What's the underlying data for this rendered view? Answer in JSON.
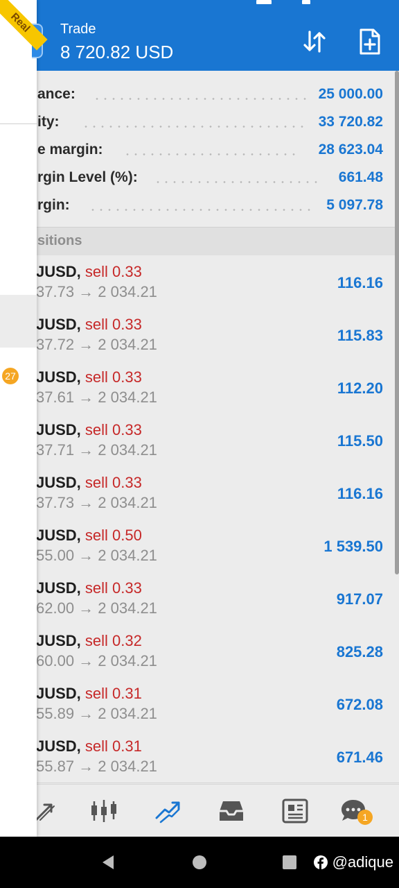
{
  "header": {
    "title": "Trade",
    "amount": "8 720.82 USD",
    "sort_icon": "sort-arrows-icon",
    "new_order_icon": "new-order-icon"
  },
  "summary": [
    {
      "label": "ance:",
      "value": "25 000.00"
    },
    {
      "label": "ity:",
      "value": "33 720.82"
    },
    {
      "label": "e margin:",
      "value": "28 623.04"
    },
    {
      "label": "rgin Level (%):",
      "value": "661.48"
    },
    {
      "label": "rgin:",
      "value": "5 097.78"
    }
  ],
  "positions_header": "sitions",
  "positions": [
    {
      "symbol": "JUSD,",
      "side": "sell 0.33",
      "prices": "37.73 → 2 034.21",
      "profit": "116.16"
    },
    {
      "symbol": "JUSD,",
      "side": "sell 0.33",
      "prices": "37.72 → 2 034.21",
      "profit": "115.83"
    },
    {
      "symbol": "JUSD,",
      "side": "sell 0.33",
      "prices": "37.61 → 2 034.21",
      "profit": "112.20"
    },
    {
      "symbol": "JUSD,",
      "side": "sell 0.33",
      "prices": "37.71 → 2 034.21",
      "profit": "115.50"
    },
    {
      "symbol": "JUSD,",
      "side": "sell 0.33",
      "prices": "37.73 → 2 034.21",
      "profit": "116.16"
    },
    {
      "symbol": "JUSD,",
      "side": "sell 0.50",
      "prices": "55.00 → 2 034.21",
      "profit": "1 539.50"
    },
    {
      "symbol": "JUSD,",
      "side": "sell 0.33",
      "prices": "62.00 → 2 034.21",
      "profit": "917.07"
    },
    {
      "symbol": "JUSD,",
      "side": "sell 0.32",
      "prices": "60.00 → 2 034.21",
      "profit": "825.28"
    },
    {
      "symbol": "JUSD,",
      "side": "sell 0.31",
      "prices": "55.89 → 2 034.21",
      "profit": "672.08"
    },
    {
      "symbol": "JUSD,",
      "side": "sell 0.31",
      "prices": "55.87 → 2 034.21",
      "profit": "671.46"
    }
  ],
  "bottom_nav": {
    "items": [
      "quotes-icon",
      "chart-candles-icon",
      "trade-icon",
      "history-inbox-icon",
      "news-icon",
      "chat-icon"
    ],
    "active": "trade-icon",
    "chat_badge": "1"
  },
  "drawer": {
    "badge": "27",
    "ribbon": "Real"
  },
  "watermark": "@adique",
  "colors": {
    "header": "#1976d2",
    "accent": "#1976d2",
    "sell": "#c62828",
    "badge": "#f5a623"
  }
}
